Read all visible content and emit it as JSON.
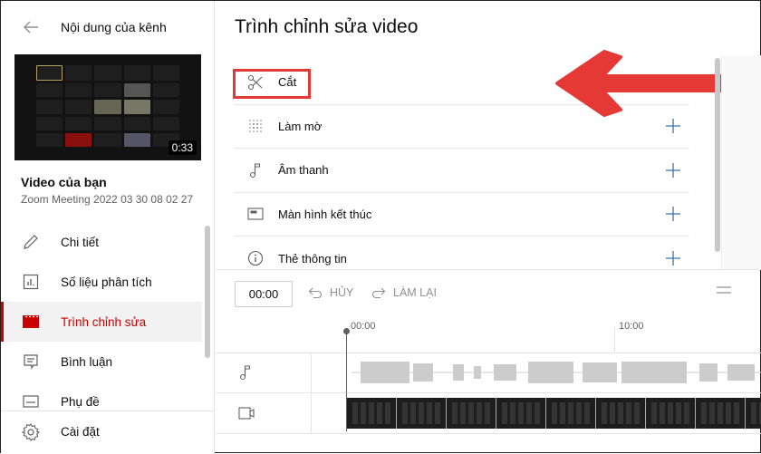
{
  "sidebar": {
    "back_label": "Quay lại",
    "channel_title": "Nội dung của kênh",
    "thumbnail": {
      "duration": "0:33"
    },
    "section_label": "Video của bạn",
    "video_name": "Zoom Meeting 2022 03 30 08 02 27",
    "items": [
      {
        "label": "Chi tiết",
        "icon": "pencil-icon",
        "active": false
      },
      {
        "label": "Số liệu phân tích",
        "icon": "analytics-icon",
        "active": false
      },
      {
        "label": "Trình chỉnh sửa",
        "icon": "editor-icon",
        "active": true
      },
      {
        "label": "Bình luận",
        "icon": "comment-icon",
        "active": false
      },
      {
        "label": "Phụ đề",
        "icon": "subtitles-icon",
        "active": false
      }
    ],
    "settings_label": "Cài đặt"
  },
  "main": {
    "title": "Trình chỉnh sửa video",
    "tools": [
      {
        "label": "Cắt",
        "icon": "scissors-icon"
      },
      {
        "label": "Làm mờ",
        "icon": "blur-icon"
      },
      {
        "label": "Âm thanh",
        "icon": "music-note-icon"
      },
      {
        "label": "Màn hình kết thúc",
        "icon": "end-screen-icon"
      },
      {
        "label": "Thẻ thông tin",
        "icon": "info-icon"
      }
    ],
    "timeline": {
      "current_time": "00:00",
      "undo_label": "HỦY",
      "redo_label": "LÀM LẠI",
      "ruler": [
        "00:00",
        "10:00"
      ]
    }
  },
  "colors": {
    "accent": "#cc0000",
    "annotation": "#e53935",
    "plus": "#3d6fa8"
  }
}
